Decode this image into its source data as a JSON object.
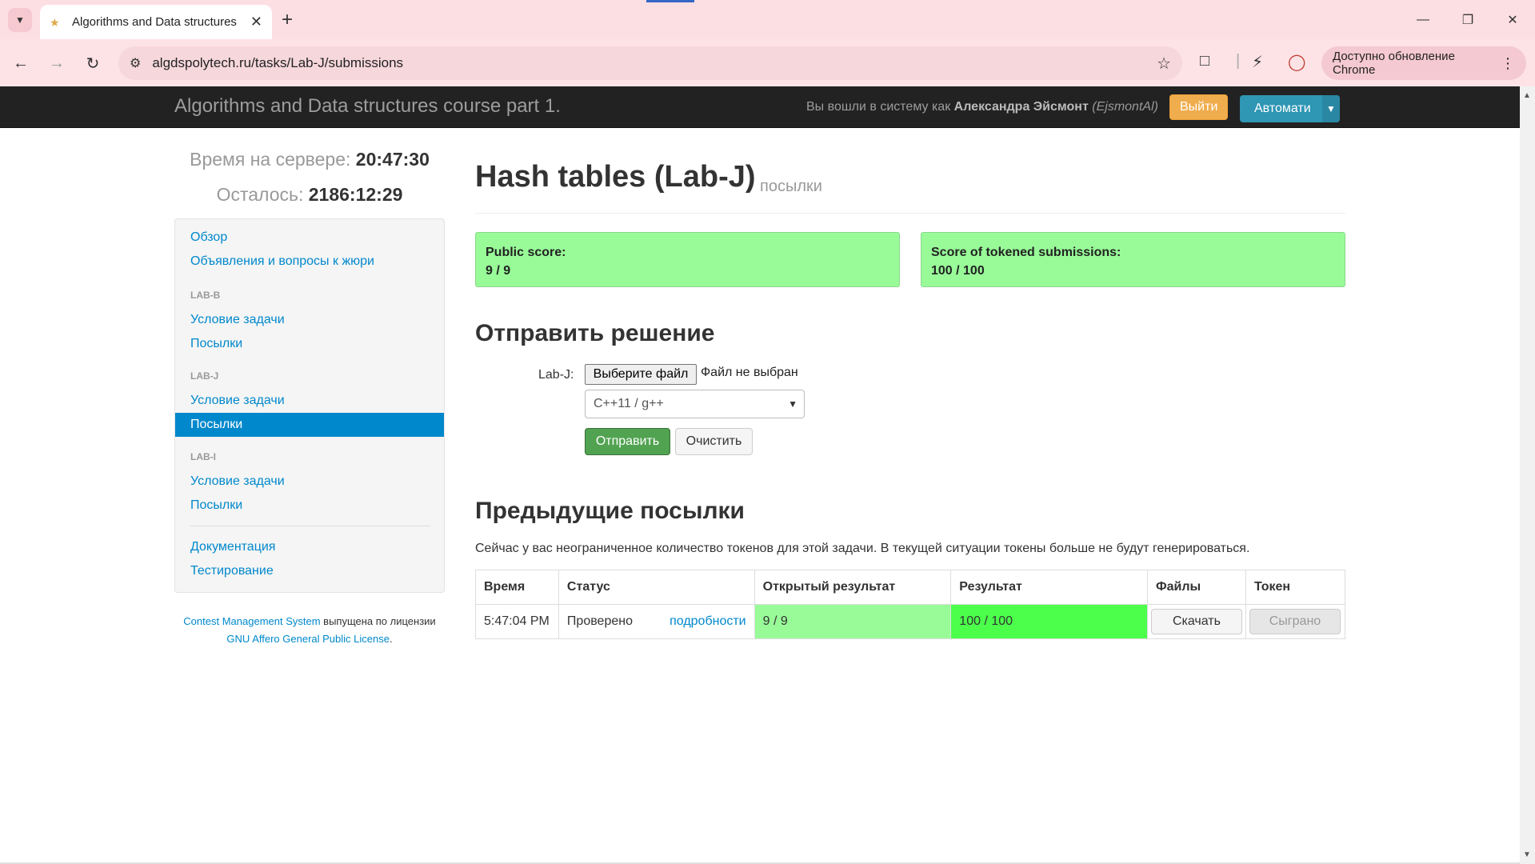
{
  "browser": {
    "tab_title": "Algorithms and Data structures",
    "url": "algdspolytech.ru/tasks/Lab-J/submissions",
    "update_button": "Доступно обновление Chrome"
  },
  "navbar": {
    "brand": "Algorithms and Data structures course part 1.",
    "login_prefix": "Вы вошли в систему как",
    "user_name": "Александра Эйсмонт",
    "user_login": "(EjsmontAl)",
    "logout_label": "Выйти",
    "language_label": "Автомати"
  },
  "sidebar": {
    "server_time_label": "Время на сервере:",
    "server_time": "20:47:30",
    "remaining_label": "Осталось:",
    "remaining": "2186:12:29",
    "overview": "Обзор",
    "announcements": "Объявления и вопросы к жюри",
    "tasks": [
      {
        "header": "LAB-B",
        "statement": "Условие задачи",
        "submissions": "Посылки"
      },
      {
        "header": "LAB-J",
        "statement": "Условие задачи",
        "submissions": "Посылки"
      },
      {
        "header": "LAB-I",
        "statement": "Условие задачи",
        "submissions": "Посылки"
      }
    ],
    "documentation": "Документация",
    "testing": "Тестирование",
    "license_link1": "Contest Management System",
    "license_text1": "выпущена по лицензии",
    "license_link2": "GNU Affero General Public License",
    "license_end": "."
  },
  "main": {
    "title": "Hash tables (Lab-J)",
    "subtitle": "посылки",
    "public_score_label": "Public score:",
    "public_score": "9 / 9",
    "tokened_score_label": "Score of tokened submissions:",
    "tokened_score": "100 / 100",
    "submit_title": "Отправить решение",
    "file_label": "Lab-J:",
    "file_button": "Выберите файл",
    "file_status": "Файл не выбран",
    "language_selected": "C++11 / g++",
    "submit_button": "Отправить",
    "clear_button": "Очистить",
    "previous_title": "Предыдущие посылки",
    "tokens_note": "Сейчас у вас неограниченное количество токенов для этой задачи. В текущей ситуации токены больше не будут генерироваться.",
    "table": {
      "headers": [
        "Время",
        "Статус",
        "Открытый результат",
        "Результат",
        "Файлы",
        "Токен"
      ],
      "rows": [
        {
          "time": "5:47:04 PM",
          "status": "Проверено",
          "details": "подробности",
          "public_result": "9 / 9",
          "result": "100 / 100",
          "files": "Скачать",
          "token": "Сыграно"
        }
      ]
    }
  }
}
